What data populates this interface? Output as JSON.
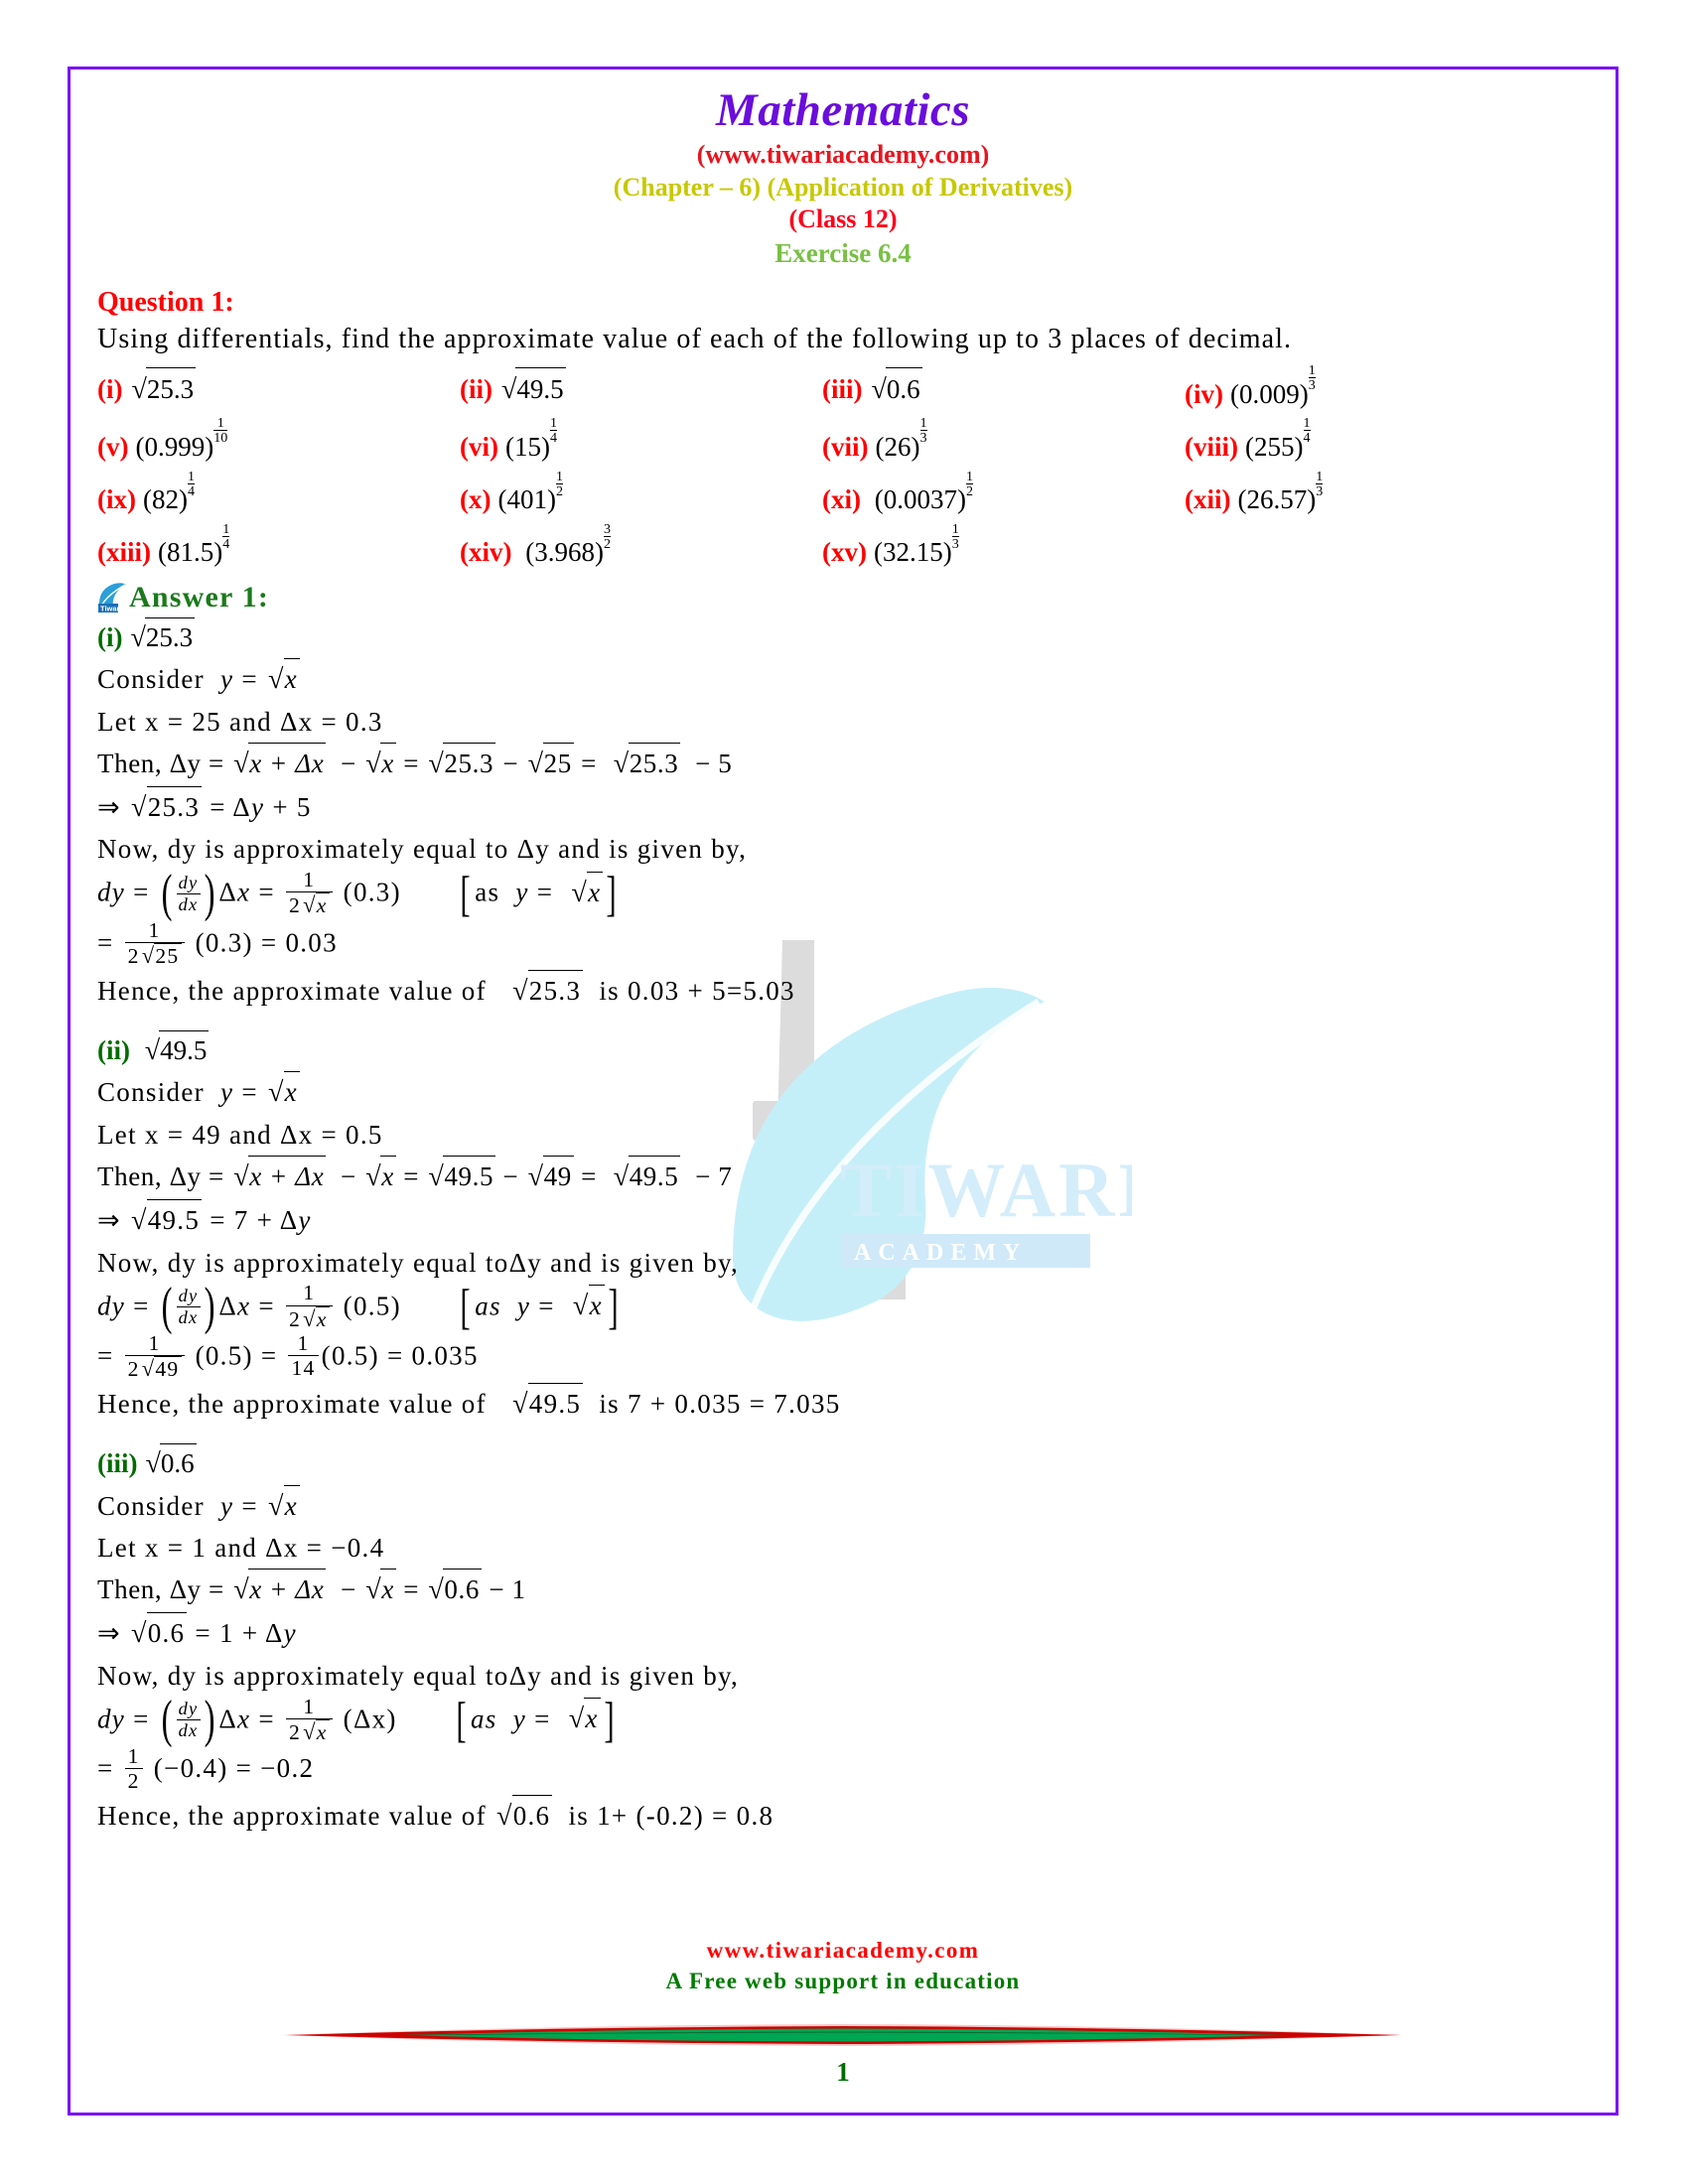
{
  "header": {
    "title": "Mathematics",
    "site": "(www.tiwariacademy.com)",
    "chapter": "(Chapter – 6) (Application of Derivatives)",
    "class": "(Class 12)",
    "exercise": "Exercise 6.4",
    "colors": {
      "title": "#6A0DDD",
      "site": "#E8141E",
      "chapter": "#C8C800",
      "class": "#FF0019",
      "exercise": "#78C043",
      "border": "#7B0CF5"
    }
  },
  "question": {
    "heading": "Question 1:",
    "text": "Using differentials, find the approximate value of each of the following up to 3 places of decimal.",
    "items": [
      {
        "label": "(i)",
        "expr": "√25.3",
        "base": "25.3",
        "form": "sqrt"
      },
      {
        "label": "(ii)",
        "expr": "√49.5",
        "base": "49.5",
        "form": "sqrt"
      },
      {
        "label": "(iii)",
        "expr": "√0.6",
        "base": "0.6",
        "form": "sqrt"
      },
      {
        "label": "(iv)",
        "expr": "(0.009)^(1/3)",
        "base": "0.009",
        "form": "pow",
        "num": "1",
        "den": "3"
      },
      {
        "label": "(v)",
        "expr": "(0.999)^(1/10)",
        "base": "0.999",
        "form": "pow",
        "num": "1",
        "den": "10"
      },
      {
        "label": "(vi)",
        "expr": "(15)^(1/4)",
        "base": "15",
        "form": "pow",
        "num": "1",
        "den": "4"
      },
      {
        "label": "(vii)",
        "expr": "(26)^(1/3)",
        "base": "26",
        "form": "pow",
        "num": "1",
        "den": "3"
      },
      {
        "label": "(viii)",
        "expr": "(255)^(1/4)",
        "base": "255",
        "form": "pow",
        "num": "1",
        "den": "4"
      },
      {
        "label": "(ix)",
        "expr": "(82)^(1/4)",
        "base": "82",
        "form": "pow",
        "num": "1",
        "den": "4"
      },
      {
        "label": "(x)",
        "expr": "(401)^(1/2)",
        "base": "401",
        "form": "pow",
        "num": "1",
        "den": "2"
      },
      {
        "label": "(xi)",
        "expr": "(0.0037)^(1/2)",
        "base": "0.0037",
        "form": "pow",
        "num": "1",
        "den": "2"
      },
      {
        "label": "(xii)",
        "expr": "(26.57)^(1/3)",
        "base": "26.57",
        "form": "pow",
        "num": "1",
        "den": "3"
      },
      {
        "label": "(xiii)",
        "expr": "(81.5)^(1/4)",
        "base": "81.5",
        "form": "pow",
        "num": "1",
        "den": "4"
      },
      {
        "label": "(xiv)",
        "expr": "(3.968)^(3/2)",
        "base": "3.968",
        "form": "pow",
        "num": "3",
        "den": "2"
      },
      {
        "label": "(xv)",
        "expr": "(32.15)^(1/3)",
        "base": "32.15",
        "form": "pow",
        "num": "1",
        "den": "3"
      }
    ]
  },
  "answer": {
    "heading": "Answer 1:",
    "parts": [
      {
        "label": "(i)",
        "radicand": "25.3",
        "consider": "Consider",
        "consider_eq": "y = √x",
        "let_line": "Let x = 25 and Δx = 0.3",
        "then_prefix": "Then, Δy =",
        "then_a": "√(x + Δx)",
        "then_b": "√x",
        "then_c": "√25.3",
        "then_d": "√25",
        "then_e": "√25.3",
        "then_tail": "− 5",
        "implies": "⇒ √25.3 = Δy + 5",
        "now_line": "Now, dy is approximately equal to Δy  and is given by,",
        "dy_delta": "(0.3)",
        "dy_bracket": "[as  y = √x]",
        "eval_root": "25",
        "eval_delta": "(0.3)",
        "eval_result": "=  0.03",
        "hence_prefix": "Hence, the approximate value of",
        "hence_root": "√25.3",
        "hence_tail": "is 0.03 + 5=5.03"
      },
      {
        "label": "(ii)",
        "radicand": "49.5",
        "consider": "Consider",
        "consider_eq": "y = √x",
        "let_line": "Let x = 49 and Δx = 0.5",
        "then_prefix": "Then, Δy =",
        "then_a": "√(x + Δx)",
        "then_b": "√x",
        "then_c": "√49.5",
        "then_d": "√49",
        "then_e": "√49.5",
        "then_tail": "− 7",
        "implies": "⇒ √49.5 = 7 + Δy",
        "now_line": "Now, dy is approximately equal toΔy  and is given by,",
        "dy_delta": "(0.5)",
        "dy_bracket": "[as  y = √x]",
        "eval_root": "49",
        "eval_delta": "(0.5)",
        "eval_mid_num": "1",
        "eval_mid_den": "14",
        "eval_result": "= 0.035",
        "hence_prefix": "Hence, the approximate value of",
        "hence_root": "√49.5",
        "hence_tail": "is 7 + 0.035 = 7.035"
      },
      {
        "label": "(iii)",
        "radicand": "0.6",
        "consider": "Consider",
        "consider_eq": "y = √x",
        "let_line": "Let x = 1 and Δx = −0.4",
        "then_prefix": "Then, Δy =",
        "then_a": "√(x + Δx)",
        "then_b": "√x",
        "then_c": "√0.6",
        "then_tail": "− 1",
        "implies": "⇒ √0.6 = 1 + Δy",
        "now_line": "Now, dy is approximately equal toΔy  and is given by,",
        "dy_delta": "(Δx)",
        "dy_bracket": "[as  y = √x]",
        "eval_half_num": "1",
        "eval_half_den": "2",
        "eval_delta": "(−0.4)",
        "eval_result": "= −0.2",
        "hence_prefix": "Hence, the approximate value of",
        "hence_root": "√0.6",
        "hence_tail": "is 1+ (-0.2) = 0.8"
      }
    ]
  },
  "watermark": {
    "brand_top": "TIWARI",
    "brand_bottom": "A C A D E M Y",
    "leaf_color": "#C5EFF8",
    "text_color": "#CDE9F7"
  },
  "footer": {
    "site": "www.tiwariacademy.com",
    "tagline": "A Free web support in education",
    "page_number": "1"
  }
}
